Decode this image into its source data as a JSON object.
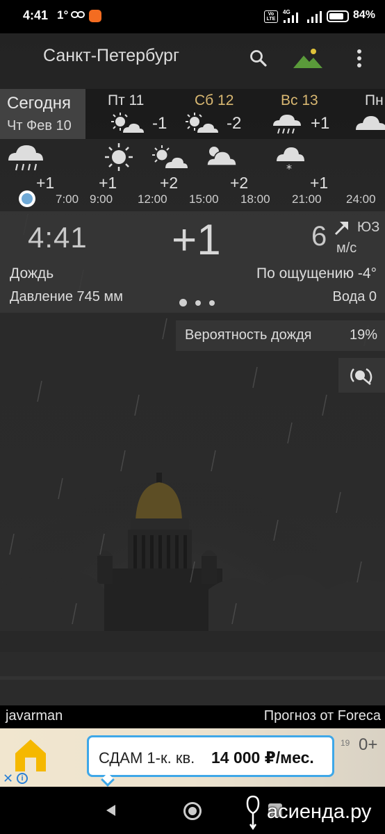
{
  "status_bar": {
    "time": "4:41",
    "temp": "1°",
    "network": "4G",
    "volte": "Vo LTE",
    "battery_pct": "84%",
    "battery_level": 0.84
  },
  "header": {
    "city": "Санкт-Петербург",
    "icons": [
      "search-icon",
      "mountain-icon",
      "more-icon"
    ]
  },
  "days": {
    "today": {
      "name": "Сегодня",
      "date": "Чт Фев 10"
    },
    "items": [
      {
        "name": "Пт 11",
        "temp": "-1",
        "icon": "sun-cloud-icon",
        "weekend": false
      },
      {
        "name": "Сб 12",
        "temp": "-2",
        "icon": "sun-cloud-icon",
        "weekend": true
      },
      {
        "name": "Вс 13",
        "temp": "+1",
        "icon": "rain-cloud-icon",
        "weekend": true
      },
      {
        "name": "Пн",
        "temp": "",
        "icon": "cloud-icon",
        "weekend": false
      }
    ]
  },
  "hourly": {
    "temps": [
      "+1",
      "+1",
      "+2",
      "+2",
      "+1"
    ],
    "times": [
      "7:00",
      "9:00",
      "12:00",
      "15:00",
      "18:00",
      "21:00",
      "24:00"
    ],
    "icons": [
      "rain-cloud-icon",
      "sun-icon",
      "sun-cloud-icon",
      "partly-cloudy-icon",
      "snow-cloud-icon"
    ]
  },
  "current": {
    "time": "4:41",
    "temp": "+1",
    "wind_speed": "6",
    "wind_unit": "м/с",
    "wind_dir": "ЮЗ",
    "condition": "Дождь",
    "feels_like": "По ощущению -4°",
    "pressure": "Давление 745 мм",
    "water": "Вода 0"
  },
  "rain_probability": {
    "label": "Вероятность дождя",
    "value": "19%"
  },
  "footer": {
    "author": "javarman",
    "source": "Прогноз от Foreca"
  },
  "ad": {
    "text1": "СДАМ 1-к. кв.",
    "text2": "14 000 ₽/мес.",
    "age": "0+",
    "number": "19",
    "close": "✕",
    "info": "i",
    "brand_color": "#f5b800",
    "accent": "#3ea7e8"
  },
  "watermark": "асиенда.ру",
  "colors": {
    "weekend": "#d9b872",
    "now_dot": "#6fa9d6",
    "panel": "#373737"
  }
}
